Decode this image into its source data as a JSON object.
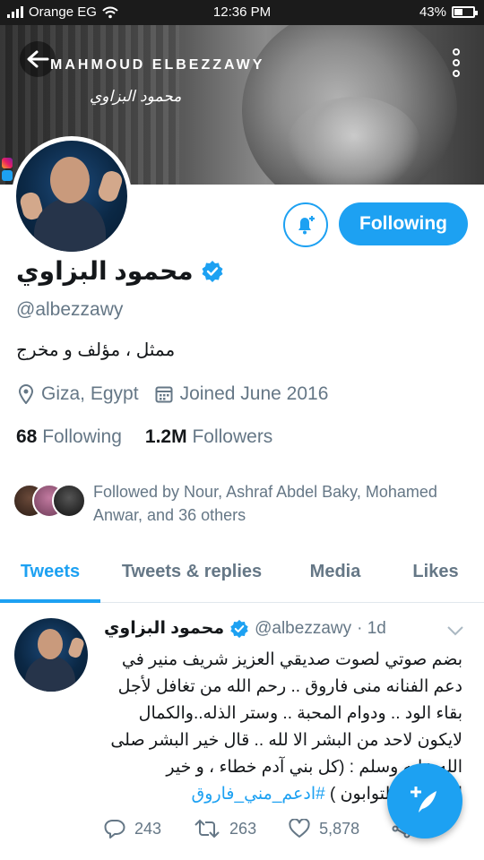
{
  "status_bar": {
    "carrier": "Orange EG",
    "time": "12:36 PM",
    "battery": "43%",
    "battery_level": 0.43
  },
  "banner": {
    "title": "MAHMOUD ELBEZZAWY",
    "signature": "محمود البزاوي"
  },
  "profile": {
    "follow_button": "Following",
    "display_name": "محمود البزاوي",
    "handle": "@albezzawy",
    "bio": "ممثل ، مؤلف و مخرج",
    "location": "Giza, Egypt",
    "joined": "Joined June 2016",
    "following_count": "68",
    "following_label": "Following",
    "followers_count": "1.2M",
    "followers_label": "Followers",
    "followed_by": "Followed by Nour, Ashraf Abdel Baky, Mohamed Anwar, and 36 others"
  },
  "tabs": [
    {
      "label": "Tweets",
      "active": true
    },
    {
      "label": "Tweets & replies",
      "active": false
    },
    {
      "label": "Media",
      "active": false
    },
    {
      "label": "Likes",
      "active": false
    }
  ],
  "tweet": {
    "name": "محمود البزاوي",
    "handle": "@albezzawy",
    "time": "· 1d",
    "text": "بضم صوتي لصوت صديقي العزيز شريف منير في دعم الفنانه منى فاروق .. رحم الله من تغافل لأجل بقاء الود .. ودوام المحبة .. وستر الذله..والكمال لايكون لاحد من البشر الا لله .. قال خير البشر صلى الله عليه وسلم : (كل بني آدم خطاء ، و خير الخطائين التوابون )",
    "hashtag": "#ادعم_مني_فاروق",
    "replies": "243",
    "retweets": "263",
    "likes": "5,878"
  },
  "colors": {
    "accent": "#1da1f2",
    "text_secondary": "#657786",
    "text_primary": "#14171a"
  },
  "icons": {
    "back": "arrow-left-icon",
    "more": "more-vertical-icon",
    "notify": "bell-plus-icon",
    "verified": "verified-badge-icon",
    "location": "location-pin-icon",
    "calendar": "calendar-icon",
    "reply": "reply-icon",
    "retweet": "retweet-icon",
    "like": "heart-icon",
    "share": "share-icon",
    "compose": "compose-tweet-icon"
  }
}
